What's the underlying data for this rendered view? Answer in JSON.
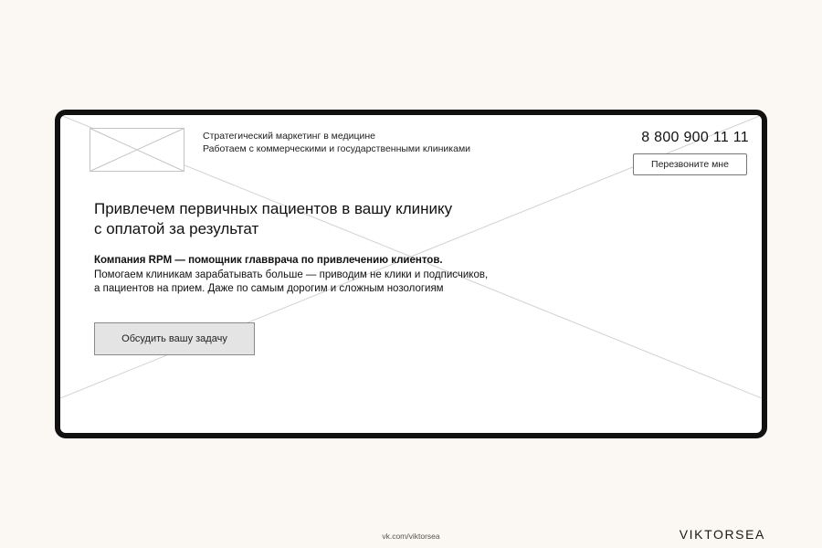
{
  "header": {
    "tagline_line1": "Стратегический маркетинг в медицине",
    "tagline_line2": "Работаем с коммерческими и государственными клиниками",
    "phone": "8 800 900 11 11",
    "callback_label": "Перезвоните мне"
  },
  "hero": {
    "headline_line1": "Привлечем первичных пациентов в вашу клинику",
    "headline_line2": "с оплатой за результат",
    "lead_strong": "Компания RPM — помощник главврача по привлечению клиентов.",
    "lead_line2": "Помогаем клиникам зарабатывать больше — приводим не клики и подписчиков,",
    "lead_line3": "а пациентов на прием. Даже по самым дорогим и сложным нозологиям",
    "cta_label": "Обсудить вашу задачу"
  },
  "footer": {
    "link": "vk.com/viktorsea",
    "brand": "VIKTORSEA"
  },
  "icons": {
    "logo": "image-placeholder-icon",
    "hero_background": "image-placeholder-icon"
  },
  "colors": {
    "page_background": "#fbf7f3",
    "frame_border": "#111111",
    "cta_background": "#e4e4e4"
  }
}
